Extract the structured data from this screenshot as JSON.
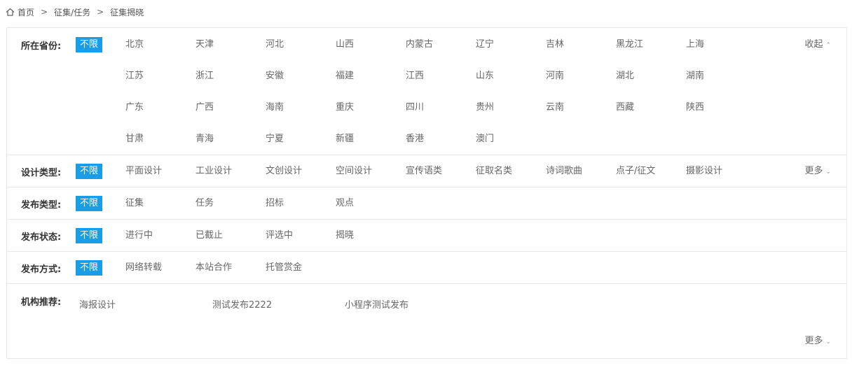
{
  "breadcrumb": {
    "home": "首页",
    "sep1": ">",
    "level2": "征集/任务",
    "sep2": ">",
    "current": "征集揭晓"
  },
  "filters": {
    "province": {
      "label": "所在省份:",
      "all": "不限",
      "toggle": "收起",
      "toggle_icon": "chevron-up",
      "options": [
        "北京",
        "天津",
        "河北",
        "山西",
        "内蒙古",
        "辽宁",
        "吉林",
        "黑龙江",
        "上海",
        "江苏",
        "浙江",
        "安徽",
        "福建",
        "江西",
        "山东",
        "河南",
        "湖北",
        "湖南",
        "广东",
        "广西",
        "海南",
        "重庆",
        "四川",
        "贵州",
        "云南",
        "西藏",
        "陕西",
        "甘肃",
        "青海",
        "宁夏",
        "新疆",
        "香港",
        "澳门"
      ]
    },
    "design_type": {
      "label": "设计类型:",
      "all": "不限",
      "toggle": "更多",
      "toggle_icon": "chevron-down",
      "options": [
        "平面设计",
        "工业设计",
        "文创设计",
        "空间设计",
        "宣传语类",
        "征取名类",
        "诗词歌曲",
        "点子/征文",
        "摄影设计"
      ]
    },
    "publish_type": {
      "label": "发布类型:",
      "all": "不限",
      "options": [
        "征集",
        "任务",
        "招标",
        "观点"
      ]
    },
    "publish_status": {
      "label": "发布状态:",
      "all": "不限",
      "options": [
        "进行中",
        "已截止",
        "评选中",
        "揭晓"
      ]
    },
    "publish_method": {
      "label": "发布方式:",
      "all": "不限",
      "options": [
        "网络转载",
        "本站合作",
        "托管赏金"
      ]
    },
    "org": {
      "label": "机构推荐:",
      "options": [
        "海报设计",
        "测试发布2222",
        "小程序测试发布"
      ],
      "toggle": "更多",
      "toggle_icon": "chevron-down"
    }
  },
  "colors": {
    "accent": "#1a9de8",
    "border": "#e8e8e8",
    "text": "#666666"
  }
}
